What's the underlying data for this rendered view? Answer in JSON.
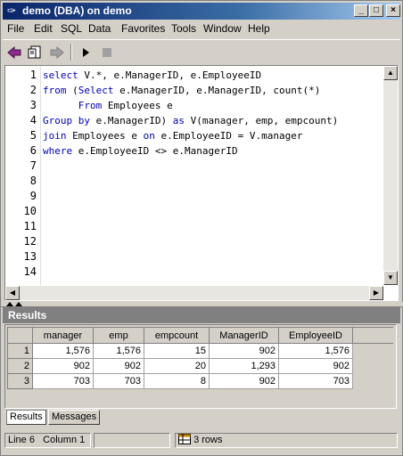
{
  "window": {
    "title": "demo (DBA) on demo",
    "controls": [
      "_",
      "□",
      "×"
    ]
  },
  "menu": {
    "items": [
      "File",
      "Edit",
      "SQL",
      "Data",
      "Favorites",
      "Tools",
      "Window",
      "Help"
    ]
  },
  "toolbar": {
    "icons": [
      "back-arrow-icon",
      "open-icon",
      "forward-arrow-icon",
      "execute-icon",
      "stop-icon"
    ]
  },
  "editor": {
    "line_numbers": [
      "1",
      "2",
      "3",
      "4",
      "5",
      "6",
      "7",
      "8",
      "9",
      "10",
      "11",
      "12",
      "13",
      "14"
    ],
    "lines": [
      "select V.*, e.ManagerID, e.EmployeeID",
      "from (Select e.ManagerID, e.ManagerID, count(*)",
      "      From Employees e",
      "Group by e.ManagerID) as V(manager, emp, empcount)",
      "join Employees e on e.EmployeeID = V.manager",
      "where e.EmployeeID <> e.ManagerID"
    ]
  },
  "results": {
    "header": "Results",
    "columns": [
      "manager",
      "emp",
      "empcount",
      "ManagerID",
      "EmployeeID"
    ],
    "rows": [
      {
        "num": "1",
        "cells": [
          "1,576",
          "1,576",
          "15",
          "902",
          "1,576"
        ]
      },
      {
        "num": "2",
        "cells": [
          "902",
          "902",
          "20",
          "1,293",
          "902"
        ]
      },
      {
        "num": "3",
        "cells": [
          "703",
          "703",
          "8",
          "902",
          "703"
        ]
      }
    ],
    "tabs": [
      "Results",
      "Messages"
    ],
    "active_tab": "Results"
  },
  "status": {
    "line": "Line 6",
    "column": "Column 1",
    "rows": "3 rows"
  },
  "colors": {
    "keyword": "#0000c0",
    "title_bar": "#0a246a",
    "back_arrow": "#8b2d8b"
  }
}
